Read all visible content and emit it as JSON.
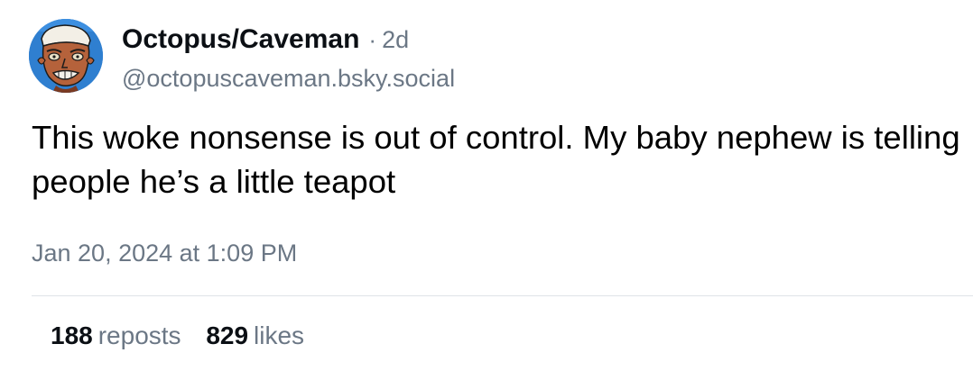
{
  "post": {
    "author": {
      "display_name": "Octopus/Caveman",
      "separator": "·",
      "age": "2d",
      "handle": "@octopuscaveman.bsky.social"
    },
    "text": "This woke nonsense is out of control. My baby nephew is telling people he’s a little teapot",
    "timestamp": "Jan 20, 2024 at 1:09 PM",
    "stats": {
      "reposts_count": "188",
      "reposts_label": "reposts",
      "likes_count": "829",
      "likes_label": "likes"
    }
  },
  "colors": {
    "secondary_text": "#6b7785",
    "divider": "#dfe3e8",
    "avatar_background": "#2f7fd0"
  },
  "icons": {
    "avatar": "painted-face-avatar"
  }
}
